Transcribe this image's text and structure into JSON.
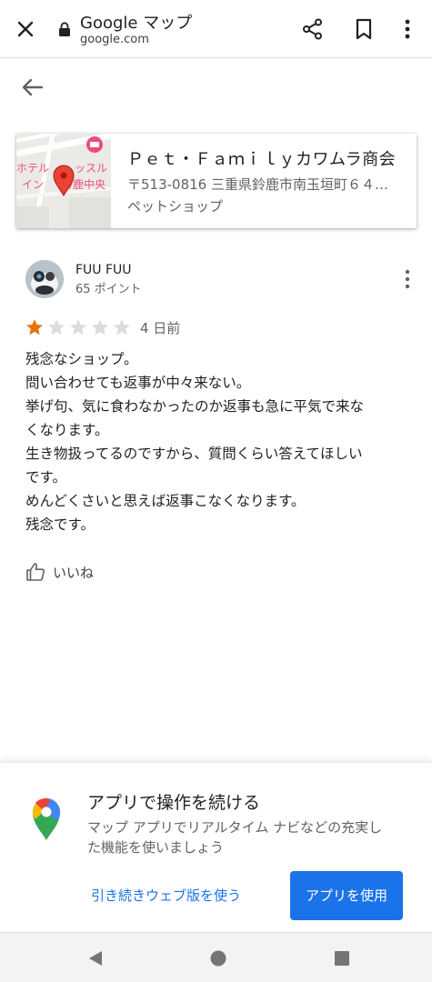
{
  "browser": {
    "title": "Google マップ",
    "url": "google.com",
    "icons": [
      "close-icon",
      "lock-icon",
      "share-icon",
      "bookmark-icon",
      "more-vert-icon"
    ]
  },
  "place": {
    "name": "Ｐｅｔ・Ｆａｍｉｌｙカワムラ商会",
    "address": "〒513-0816 三重県鈴鹿市南玉垣町６４…",
    "category": "ペットショップ",
    "map_labels": [
      "ホテル",
      "ッスル",
      "イン",
      "鈴鹿中央"
    ]
  },
  "review": {
    "author": "FUU FUU",
    "points": "65 ポイント",
    "rating": 1,
    "max_rating": 5,
    "date": "4 日前",
    "lines": [
      "残念なショップ。",
      "問い合わせても返事が中々来ない。",
      "挙げ句、気に食わなかったのか返事も急に平気で来な",
      "くなります。",
      "生き物扱ってるのですから、質問くらい答えてほしい",
      "です。",
      "めんどくさいと思えば返事こなくなります。",
      "残念です。"
    ],
    "like_label": "いいね"
  },
  "promo": {
    "title": "アプリで操作を続ける",
    "body_lines": [
      "マップ アプリでリアルタイム ナビなどの充実し",
      "た機能を使いましょう"
    ],
    "web_button": "引き続きウェブ版を使う",
    "app_button": "アプリを使用"
  },
  "colors": {
    "accent": "#1a73e8",
    "star_filled": "#e8710a",
    "star_empty": "#dadce0",
    "pin_red": "#ea4335"
  }
}
